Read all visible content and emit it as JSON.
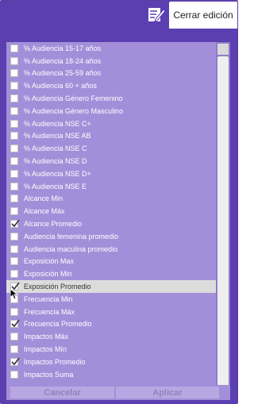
{
  "toolbar": {
    "close_label": "Cerrar edición",
    "edit_icon": "edit-icon"
  },
  "filter_list": {
    "items": [
      {
        "label": "% Audiencia 15-17 años",
        "checked": false
      },
      {
        "label": "% Audiencia 18-24 años",
        "checked": false
      },
      {
        "label": "% Audiencia 25-59 años",
        "checked": false
      },
      {
        "label": "% Audiencia 60 + años",
        "checked": false
      },
      {
        "label": "% Audiencia Género Femenino",
        "checked": false
      },
      {
        "label": "% Audiencia Género Masculino",
        "checked": false
      },
      {
        "label": "% Audiencia NSE C+",
        "checked": false
      },
      {
        "label": "% Audiencia NSE AB",
        "checked": false
      },
      {
        "label": "% Audiencia NSE C",
        "checked": false
      },
      {
        "label": "% Audiencia NSE D",
        "checked": false
      },
      {
        "label": "% Audiencia NSE D+",
        "checked": false
      },
      {
        "label": "% Audiencia NSE E",
        "checked": false
      },
      {
        "label": "Alcance Min",
        "checked": false
      },
      {
        "label": "Alcance Máx",
        "checked": false
      },
      {
        "label": "Alcance Promedio",
        "checked": true
      },
      {
        "label": "Audiencia femenina promedio",
        "checked": false
      },
      {
        "label": "Audiencia maculina promedio",
        "checked": false
      },
      {
        "label": "Exposición Max",
        "checked": false
      },
      {
        "label": "Exposición Min",
        "checked": false
      },
      {
        "label": "Exposición Promedio",
        "checked": true,
        "hover": true
      },
      {
        "label": "Frecuencia Min",
        "checked": false
      },
      {
        "label": "Frecuencia Máx",
        "checked": false
      },
      {
        "label": "Frecuencia Promedio",
        "checked": true
      },
      {
        "label": "Impactos Máx",
        "checked": false
      },
      {
        "label": "Impactos Mín",
        "checked": false
      },
      {
        "label": "Impactos Promedio",
        "checked": true
      },
      {
        "label": "Impactos Suma",
        "checked": false
      }
    ]
  },
  "footer": {
    "cancel_label": "Cancelar",
    "apply_label": "Aplicar"
  },
  "colors": {
    "background": "#5b3fb0",
    "panel": "#a38fd9",
    "hover_row": "#dcdcdc"
  }
}
